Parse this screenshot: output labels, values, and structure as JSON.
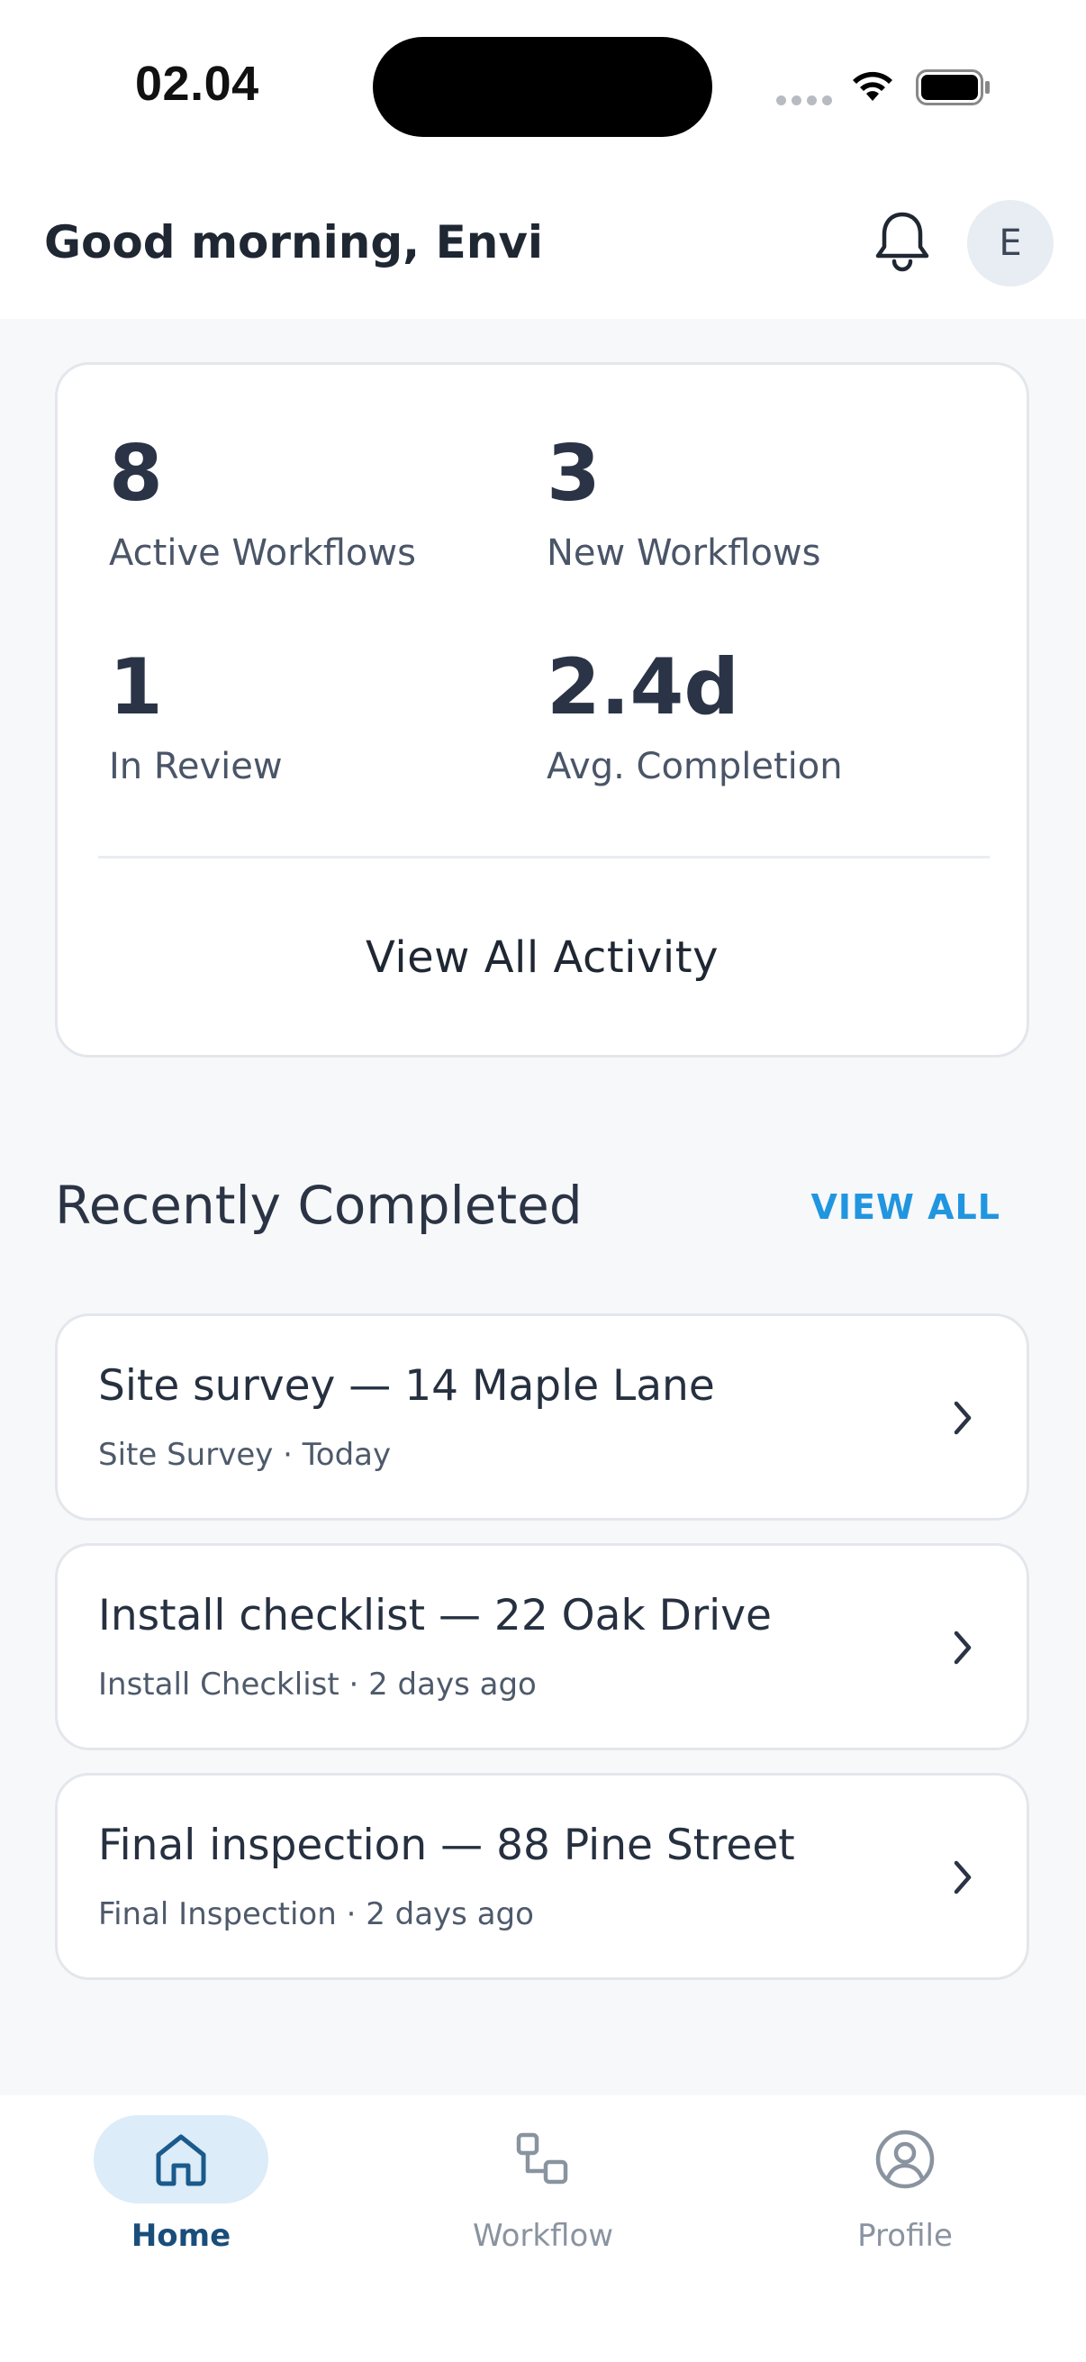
{
  "status_bar": {
    "time": "02.04"
  },
  "header": {
    "greeting": "Good morning, Envi",
    "avatar_initial": "E",
    "bell_icon": "bell-icon"
  },
  "stats": {
    "active_workflows": {
      "value": "8",
      "label": "Active Workflows"
    },
    "new_workflows": {
      "value": "3",
      "label": "New Workflows"
    },
    "in_review": {
      "value": "1",
      "label": "In Review"
    },
    "avg_completion": {
      "value": "2.4d",
      "label": "Avg. Completion"
    },
    "view_all_activity_label": "View All Activity"
  },
  "recently_completed": {
    "title": "Recently Completed",
    "view_all_label": "VIEW ALL",
    "items": [
      {
        "title": "Site survey — 14 Maple Lane",
        "meta": "Site Survey · Today"
      },
      {
        "title": "Install checklist — 22 Oak Drive",
        "meta": "Install Checklist · 2 days ago"
      },
      {
        "title": "Final inspection — 88 Pine Street",
        "meta": "Final Inspection · 2 days ago"
      }
    ]
  },
  "bottom_nav": {
    "items": [
      {
        "label": "Home",
        "icon": "home-icon",
        "active": true
      },
      {
        "label": "Workflow",
        "icon": "workflow-icon",
        "active": false
      },
      {
        "label": "Profile",
        "icon": "profile-icon",
        "active": false
      }
    ]
  },
  "colors": {
    "accent": "#2196e0",
    "nav_active_text": "#1a4e7a",
    "nav_active_bg": "#dcecf8",
    "page_bg": "#f7f8fa"
  }
}
